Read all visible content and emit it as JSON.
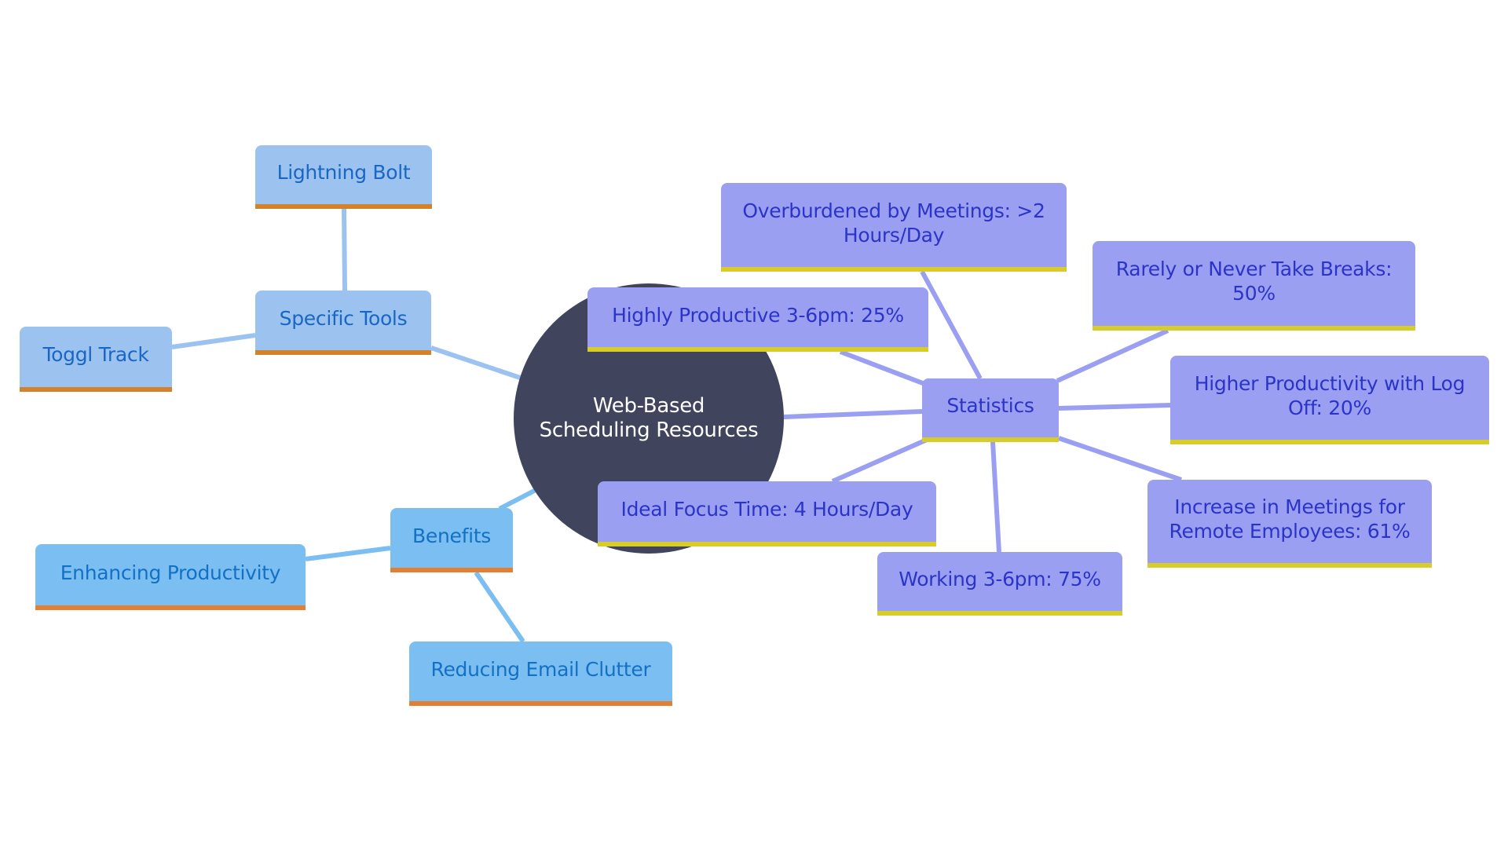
{
  "diagram": {
    "type": "mindmap",
    "root": {
      "id": "root",
      "label": "Web-Based Scheduling Resources",
      "color": "#40445c",
      "text_color": "#ffffff"
    },
    "branches": [
      {
        "id": "tools",
        "label": "Specific Tools",
        "style": {
          "fill": "#9cc3ef",
          "text": "#1a66c4",
          "accent": "#d4822a",
          "edge": "#9cc3ef"
        },
        "children": [
          {
            "id": "lightning",
            "label": "Lightning Bolt"
          },
          {
            "id": "toggl",
            "label": "Toggl Track"
          }
        ]
      },
      {
        "id": "benefits",
        "label": "Benefits",
        "style": {
          "fill": "#7bbff2",
          "text": "#1470c4",
          "accent": "#e27f32",
          "edge": "#7bbff2"
        },
        "children": [
          {
            "id": "enhancing",
            "label": "Enhancing Productivity"
          },
          {
            "id": "reducing",
            "label": "Reducing Email Clutter"
          }
        ]
      },
      {
        "id": "statistics",
        "label": "Statistics",
        "style": {
          "fill": "#9a9ff2",
          "text": "#2b34c6",
          "accent": "#d8cc28",
          "edge": "#9a9ff2"
        },
        "children": [
          {
            "id": "overburdened",
            "label": "Overburdened by Meetings: >2 Hours/Day"
          },
          {
            "id": "highly",
            "label": "Highly Productive 3-6pm: 25%"
          },
          {
            "id": "rarely",
            "label": "Rarely or Never Take Breaks: 50%"
          },
          {
            "id": "higher",
            "label": "Higher Productivity with Log Off: 20%"
          },
          {
            "id": "increase",
            "label": "Increase in Meetings for Remote Employees: 61%"
          },
          {
            "id": "working",
            "label": "Working 3-6pm: 75%"
          },
          {
            "id": "ideal",
            "label": "Ideal Focus Time: 4 Hours/Day"
          }
        ]
      }
    ]
  }
}
